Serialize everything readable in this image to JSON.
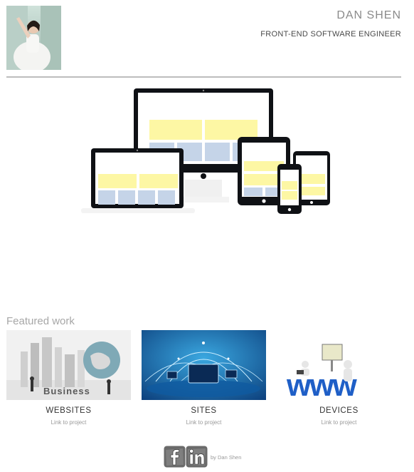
{
  "header": {
    "name": "DAN SHEN",
    "role": "FRONT-END SOFTWARE ENGINEER"
  },
  "featured": {
    "heading": "Featured work",
    "items": [
      {
        "title": "WEBSITES",
        "link": "Link to project"
      },
      {
        "title": "SITES",
        "link": "Link to project"
      },
      {
        "title": "DEVICES",
        "link": "Link to project"
      }
    ]
  },
  "footer": {
    "social": [
      "facebook-icon",
      "linkedin-icon"
    ],
    "credit": "by Dan Shen"
  },
  "colors": {
    "screen_yellow": "#fdf7a4",
    "screen_blue": "#c5d4e8",
    "device_black": "#0f1115",
    "divider": "#bdbdbd"
  }
}
